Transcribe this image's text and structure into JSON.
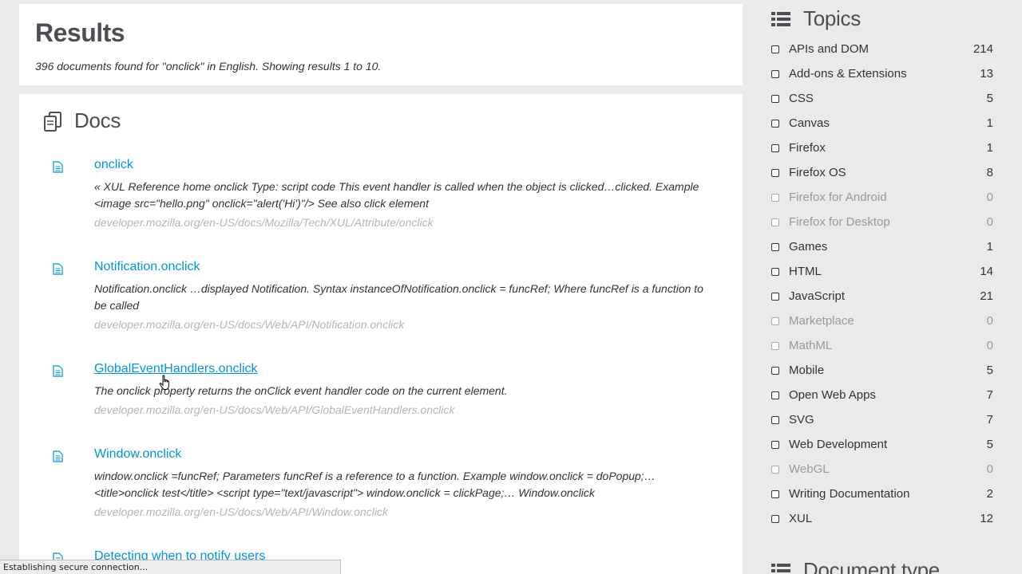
{
  "results": {
    "title": "Results",
    "summary": "396 documents found for \"onclick\" in English. Showing results 1 to 10."
  },
  "docs": {
    "title": "Docs",
    "items": [
      {
        "title": "onclick",
        "excerpt": "« XUL Reference home onclick Type: script code This event handler is called when the object is clicked…clicked. Example <image src=\"hello.png\" onclick=\"alert('Hi')\"/> See also click element",
        "url": "developer.mozilla.org/en-US/docs/Mozilla/Tech/XUL/Attribute/onclick"
      },
      {
        "title": "Notification.onclick",
        "excerpt": "Notification.onclick …displayed Notification. Syntax instanceOfNotification.onclick = funcRef; Where funcRef is a function to be called",
        "url": "developer.mozilla.org/en-US/docs/Web/API/Notification.onclick"
      },
      {
        "title": "GlobalEventHandlers.onclick",
        "excerpt": "The onclick property returns the onClick event handler code on the current element.",
        "url": "developer.mozilla.org/en-US/docs/Web/API/GlobalEventHandlers.onclick"
      },
      {
        "title": "Window.onclick",
        "excerpt": "window.onclick =funcRef; Parameters funcRef is a reference to a function. Example window.onclick = doPopup;… <title>onclick test</title> <script type=\"text/javascript\"> window.onclick = clickPage;… Window.onclick",
        "url": "developer.mozilla.org/en-US/docs/Web/API/Window.onclick"
      },
      {
        "title": "Detecting when to notify users",
        "excerpt": "",
        "url": ""
      }
    ]
  },
  "sidebar": {
    "topics_title": "Topics",
    "topics": [
      {
        "label": "APIs and DOM",
        "count": "214",
        "enabled": true
      },
      {
        "label": "Add-ons & Extensions",
        "count": "13",
        "enabled": true
      },
      {
        "label": "CSS",
        "count": "5",
        "enabled": true
      },
      {
        "label": "Canvas",
        "count": "1",
        "enabled": true
      },
      {
        "label": "Firefox",
        "count": "1",
        "enabled": true
      },
      {
        "label": "Firefox OS",
        "count": "8",
        "enabled": true
      },
      {
        "label": "Firefox for Android",
        "count": "0",
        "enabled": false
      },
      {
        "label": "Firefox for Desktop",
        "count": "0",
        "enabled": false
      },
      {
        "label": "Games",
        "count": "1",
        "enabled": true
      },
      {
        "label": "HTML",
        "count": "14",
        "enabled": true
      },
      {
        "label": "JavaScript",
        "count": "21",
        "enabled": true
      },
      {
        "label": "Marketplace",
        "count": "0",
        "enabled": false
      },
      {
        "label": "MathML",
        "count": "0",
        "enabled": false
      },
      {
        "label": "Mobile",
        "count": "5",
        "enabled": true
      },
      {
        "label": "Open Web Apps",
        "count": "7",
        "enabled": true
      },
      {
        "label": "SVG",
        "count": "7",
        "enabled": true
      },
      {
        "label": "Web Development",
        "count": "5",
        "enabled": true
      },
      {
        "label": "WebGL",
        "count": "0",
        "enabled": false
      },
      {
        "label": "Writing Documentation",
        "count": "2",
        "enabled": true
      },
      {
        "label": "XUL",
        "count": "12",
        "enabled": true
      }
    ],
    "doctype_title": "Document type"
  },
  "status_bar": {
    "text": "Establishing secure connection..."
  },
  "icons": {
    "docs": "docs-stack-icon",
    "doc": "document-icon",
    "list": "list-icon",
    "cursor": "hand-pointer-icon"
  },
  "colors": {
    "link": "#0095dd",
    "url": "#b5b5b5",
    "background": "#eaeaea"
  }
}
